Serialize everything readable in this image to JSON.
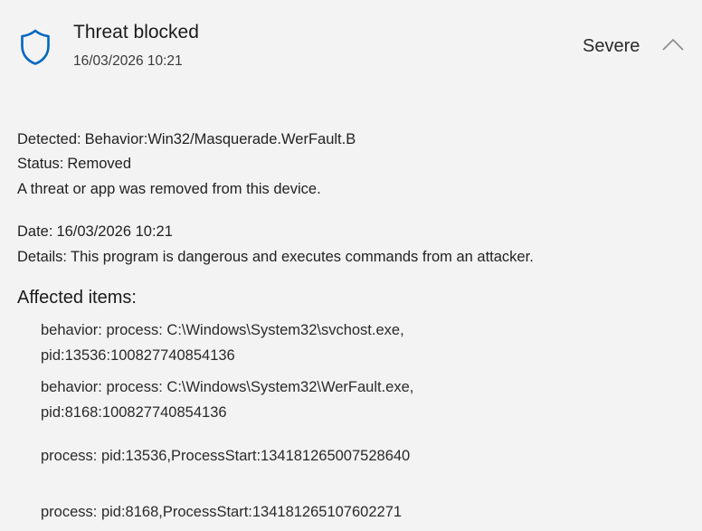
{
  "header": {
    "title": "Threat blocked",
    "timestamp": "16/03/2026 10:21",
    "severity": "Severe",
    "icon": "shield-icon",
    "expand_icon": "chevron-up-icon",
    "accent_color": "#0067c0"
  },
  "summary": {
    "detected_label": "Detected:",
    "detected_value": "Behavior:Win32/Masquerade.WerFault.B",
    "status_label": "Status:",
    "status_value": "Removed",
    "status_message": "A threat or app was removed from this device."
  },
  "details": {
    "date_label": "Date:",
    "date_value": "16/03/2026 10:21",
    "details_label": "Details:",
    "details_value": "This program is dangerous and executes commands from an attacker."
  },
  "affected": {
    "heading": "Affected items:",
    "items": [
      {
        "line1": "behavior: process: C:\\Windows\\System32\\svchost.exe,",
        "line2": "pid:13536:100827740854136"
      },
      {
        "line1": "behavior: process: C:\\Windows\\System32\\WerFault.exe,",
        "line2": "pid:8168:100827740854136"
      },
      {
        "line1": "process: pid:13536,ProcessStart:134181265007528640"
      },
      {
        "line1": "process: pid:8168,ProcessStart:134181265107602271"
      }
    ]
  }
}
